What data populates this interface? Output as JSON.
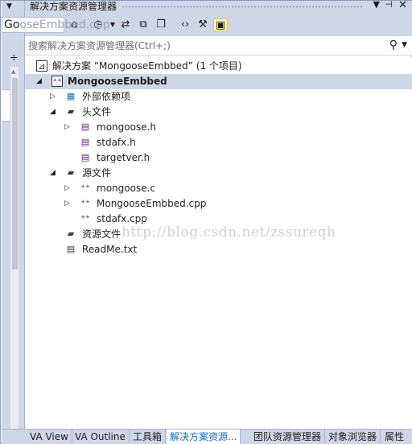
{
  "window": {
    "title": "解决方案资源管理器",
    "pin_icon": "pin-icon",
    "close_icon": "close-icon",
    "menu_icon": "dropdown-icon"
  },
  "editor_peek": {
    "text_visible": "Go",
    "text_faded": "oseEmbbed.cpp"
  },
  "toolbar": {
    "buttons": [
      {
        "name": "home-icon",
        "glyph": "⌂"
      },
      {
        "name": "history-icon",
        "glyph": "⏲"
      },
      {
        "name": "sync-icon",
        "glyph": "⇄"
      },
      {
        "name": "collapse-all-icon",
        "glyph": "⧉"
      },
      {
        "name": "show-all-files-icon",
        "glyph": "❐"
      },
      {
        "name": "view-code-icon",
        "glyph": "‹›"
      },
      {
        "name": "properties-wrench-icon",
        "glyph": "🔧"
      },
      {
        "name": "preview-selected-icon",
        "glyph": "▣"
      }
    ]
  },
  "search": {
    "placeholder": "搜索解决方案资源管理器(Ctrl+;)"
  },
  "tree": {
    "solution_label": "解决方案 “MongooseEmbbed” (1 个项目)",
    "project_label": "MongooseEmbbed",
    "ext_deps_label": "外部依赖项",
    "headers_label": "头文件",
    "header_files": [
      "mongoose.h",
      "stdafx.h",
      "targetver.h"
    ],
    "sources_label": "源文件",
    "source_files": [
      "mongoose.c",
      "MongooseEmbbed.cpp",
      "stdafx.cpp"
    ],
    "resources_label": "资源文件",
    "readme_label": "ReadMe.txt"
  },
  "watermark": "http://blog.csdn.net/zssureqh",
  "bottom_tabs": [
    "VA View",
    "VA Outline",
    "工具箱",
    "解决方案资源...",
    "团队资源管理器",
    "对象浏览器",
    "属性"
  ],
  "colors": {
    "chrome": "#cfd6e5",
    "selection": "#cfd6e5",
    "active_tab_text": "#0e70c0",
    "cpp_icon": "#68217a"
  }
}
